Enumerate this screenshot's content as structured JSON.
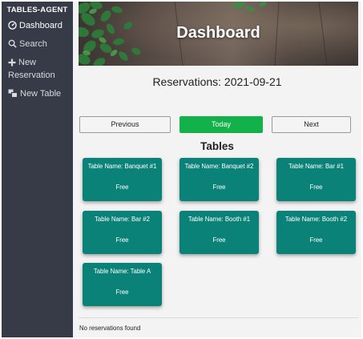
{
  "sidebar": {
    "brand": "TABLES-AGENT",
    "items": [
      {
        "label": "Dashboard",
        "icon": "dashboard-icon"
      },
      {
        "label": "Search",
        "icon": "search-icon"
      },
      {
        "label": "New Reservation",
        "icon": "plus-icon"
      },
      {
        "label": "New Table",
        "icon": "table-icon"
      }
    ]
  },
  "header": {
    "title": "Dashboard"
  },
  "reservations": {
    "title": "Reservations: 2021-09-21",
    "empty_message": "No reservations found"
  },
  "date_nav": {
    "previous": "Previous",
    "today": "Today",
    "next": "Next"
  },
  "tables": {
    "title": "Tables",
    "items": [
      {
        "name": "Table Name: Banquet #1",
        "status": "Free"
      },
      {
        "name": "Table Name: Banquet #2",
        "status": "Free"
      },
      {
        "name": "Table Name: Bar #1",
        "status": "Free"
      },
      {
        "name": "Table Name: Bar #2",
        "status": "Free"
      },
      {
        "name": "Table Name: Booth #1",
        "status": "Free"
      },
      {
        "name": "Table Name: Booth #2",
        "status": "Free"
      },
      {
        "name": "Table Name: Table A",
        "status": "Free"
      }
    ]
  },
  "colors": {
    "sidebar_bg": "#373a47",
    "today_button": "#12b14a",
    "table_card": "#0b8278",
    "page_bg": "#f2f3f2"
  }
}
